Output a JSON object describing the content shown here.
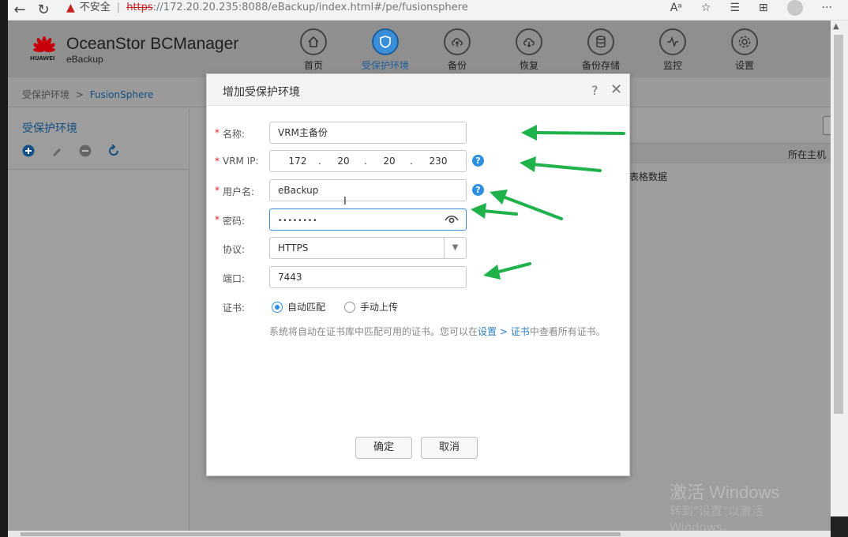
{
  "browser": {
    "warning_icon": "warning-triangle-icon",
    "unsafe_label": "不安全",
    "separator": "|",
    "url_scheme": "https",
    "url_rest": "://172.20.20.235:8088/eBackup/index.html#/pe/fusionsphere",
    "nav_back": "←",
    "nav_reload": "↻",
    "icons": [
      "read-aloud-icon",
      "favorite-add-icon",
      "favorites-icon",
      "collections-icon",
      "profile-avatar-icon",
      "more-icon"
    ],
    "more_label": "···"
  },
  "app": {
    "brand_name": "OceanStor BCManager",
    "brand_sub": "eBackup",
    "vendor": "HUAWEI",
    "brand_color": "#c7000b"
  },
  "nav": {
    "items": [
      {
        "label": "首页",
        "icon": "home-icon"
      },
      {
        "label": "受保护环境",
        "icon": "shield-icon",
        "active": true
      },
      {
        "label": "备份",
        "icon": "cloud-upload-icon"
      },
      {
        "label": "恢复",
        "icon": "cloud-download-icon"
      },
      {
        "label": "备份存储",
        "icon": "database-icon"
      },
      {
        "label": "监控",
        "icon": "pulse-icon"
      },
      {
        "label": "设置",
        "icon": "gear-icon"
      }
    ],
    "active_color": "#3a8ed8"
  },
  "breadcrumb": {
    "root": "受保护环境",
    "separator": ">",
    "current": "FusionSphere"
  },
  "sidebar": {
    "title": "受保护环境",
    "tools": [
      "add-icon",
      "edit-icon",
      "remove-icon",
      "refresh-icon"
    ]
  },
  "content": {
    "column_host": "所在主机",
    "empty_text": "表格数据"
  },
  "dialog": {
    "title": "增加受保护环境",
    "help_label": "?",
    "close_label": "✕",
    "required_mark": "*",
    "fields": {
      "name": {
        "label": "名称:",
        "value": "VRM主备份"
      },
      "vrm_ip": {
        "label": "VRM IP:",
        "octets": [
          "172",
          "20",
          "20",
          "230"
        ],
        "dot": "."
      },
      "username": {
        "label": "用户名:",
        "value": "eBackup"
      },
      "password": {
        "label": "密码:",
        "value": "••••••••"
      },
      "protocol": {
        "label": "协议:",
        "value": "HTTPS"
      },
      "port": {
        "label": "端口:",
        "value": "7443"
      },
      "cert": {
        "label": "证书:",
        "options": [
          "自动匹配",
          "手动上传"
        ],
        "selected": "自动匹配"
      }
    },
    "note_prefix": "系统将自动在证书库中匹配可用的证书。您可以在",
    "note_link1": "设置",
    "note_sep": " > ",
    "note_link2": "证书",
    "note_suffix": "中查看所有证书。",
    "help_glyph": "?",
    "ok_label": "确定",
    "cancel_label": "取消",
    "accent_color": "#2e8fe0"
  },
  "watermark": {
    "line1": "激活 Windows",
    "line2": "转到\"设置\"以激活 Windows。"
  },
  "annotation_color": "#1fb24a"
}
